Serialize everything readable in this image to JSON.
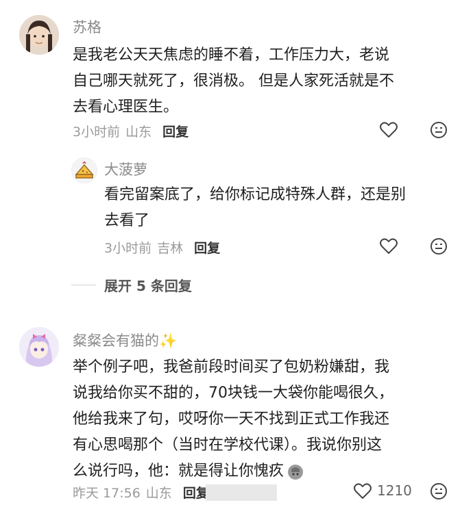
{
  "comments": [
    {
      "author": "苏格",
      "lines": [
        "是我老公天天焦虑的睡不着，工作压力大，老说",
        "自己哪天就死了，很消极。 但是人家死活就是不",
        "去看心理医生。"
      ],
      "time": "3小时前",
      "location": "山东",
      "reply_label": "回复",
      "like_icon": "heart-outline",
      "more_icon": "emoji-face"
    },
    {
      "author": "粲粲会有猫的✨",
      "lines": [
        "举个例子吧，我爸前段时间买了包奶粉嫌甜，我",
        "说我给你买不甜的，70块钱一大袋你能喝很久，",
        "他给我来了句，哎呀你一天不找到正式工作我还",
        "有心思喝那个（当时在学校代课）。我说你别这",
        "么说行吗，他：就是得让你愧疚"
      ],
      "trailing_emoji": "facepalm-emoji",
      "time": "昨天 17:56",
      "location": "山东",
      "reply_label": "回复",
      "like_count": "1210",
      "like_icon": "heart-outline",
      "more_icon": "emoji-face"
    }
  ],
  "reply": {
    "author": "大菠萝",
    "lines": [
      "看完留案底了，给你标记成特殊人群，还是别",
      "去看了"
    ],
    "time": "3小时前",
    "location": "吉林",
    "reply_label": "回复"
  },
  "expand_label": "展开 5 条回复",
  "colors": {
    "text": "#1f1f1f",
    "meta": "#9a9a9a",
    "name": "#8a8a8a"
  }
}
